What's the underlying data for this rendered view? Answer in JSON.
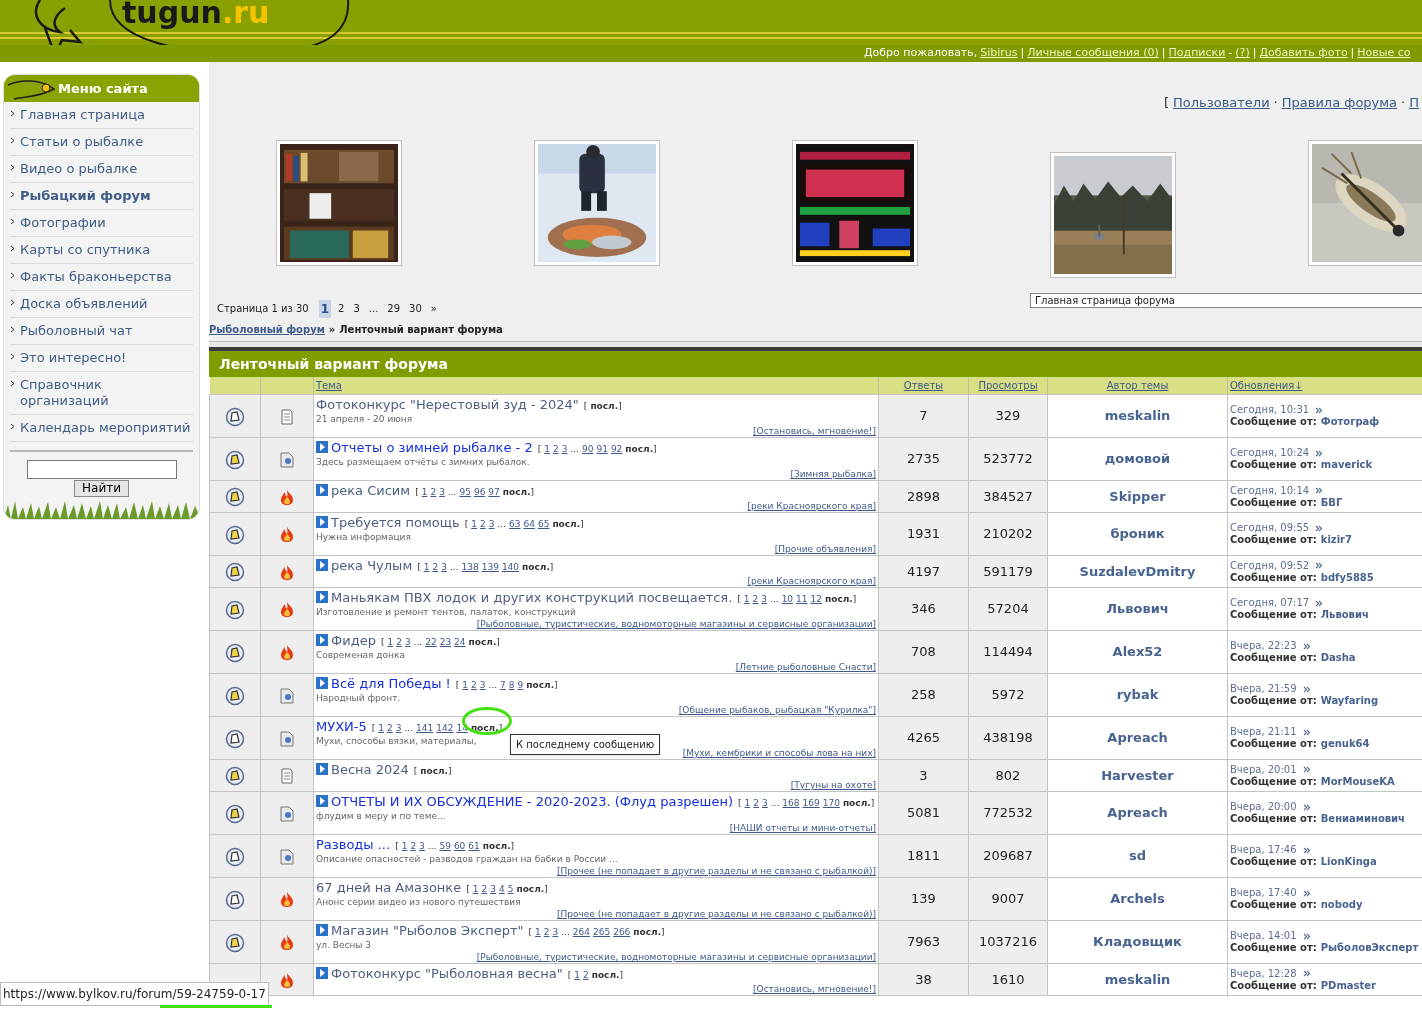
{
  "logo": {
    "main": "tugun",
    "domain": ".ru"
  },
  "user_bar": [
    {
      "kind": "text",
      "text": "Добро пожаловать,"
    },
    {
      "kind": "link",
      "text": "Sibirus"
    },
    {
      "kind": "sep",
      "text": "|"
    },
    {
      "kind": "link",
      "text": "Личные сообщения (0)"
    },
    {
      "kind": "sep",
      "text": "|"
    },
    {
      "kind": "link",
      "text": "Подписки"
    },
    {
      "kind": "sep",
      "text": "-"
    },
    {
      "kind": "link",
      "text": "(?)"
    },
    {
      "kind": "sep",
      "text": "|"
    },
    {
      "kind": "link",
      "text": "Добавить фото"
    },
    {
      "kind": "sep",
      "text": "|"
    },
    {
      "kind": "link",
      "text": "Новые со"
    }
  ],
  "sidebar": {
    "title": "Меню сайта",
    "items": [
      {
        "label": "Главная страница",
        "selected": false
      },
      {
        "label": "Статьи о рыбалке",
        "selected": false
      },
      {
        "label": "Видео о рыбалке",
        "selected": false
      },
      {
        "label": "Рыбацкий форум",
        "selected": true
      },
      {
        "label": "Фотографии",
        "selected": false
      },
      {
        "label": "Карты со спутника",
        "selected": false
      },
      {
        "label": "Факты браконьерства",
        "selected": false
      },
      {
        "label": "Доска объявлений",
        "selected": false
      },
      {
        "label": "Рыболовный чат",
        "selected": false
      },
      {
        "label": "Это интересно!",
        "selected": false
      },
      {
        "label": "Справочник организаций",
        "selected": false
      },
      {
        "label": "Календарь мероприятий",
        "selected": false
      }
    ],
    "search_button": "Найти"
  },
  "top_links": [
    {
      "kind": "sep",
      "text": "["
    },
    {
      "kind": "link",
      "text": "Пользователи"
    },
    {
      "kind": "sep",
      "text": "·"
    },
    {
      "kind": "link",
      "text": "Правила форума"
    },
    {
      "kind": "sep",
      "text": "·"
    },
    {
      "kind": "link",
      "text": "П"
    }
  ],
  "pagination": {
    "label": "Страница 1 из 30",
    "pages": [
      {
        "text": "1",
        "selected": true
      },
      {
        "text": "2",
        "selected": false
      },
      {
        "text": "3",
        "selected": false
      },
      {
        "text": "...",
        "selected": false
      },
      {
        "text": "29",
        "selected": false
      },
      {
        "text": "30",
        "selected": false
      },
      {
        "text": "»",
        "selected": false
      }
    ]
  },
  "forum_select": "Главная страница форума",
  "breadcrumb": {
    "link": "Рыболовный форум",
    "separator": "»",
    "current": "Ленточный вариант форума"
  },
  "table": {
    "title": "Ленточный вариант форума",
    "columns": [
      "Тема",
      "Ответы",
      "Просмотры",
      "Автор темы",
      "Обновления↓"
    ],
    "rows": [
      {
        "unread": false,
        "kind": "note",
        "visited": true,
        "title": "Фотоконкурс \"Нерестовый зуд - 2024\"",
        "pager": [
          {
            "kind": "sep",
            "text": "["
          },
          {
            "kind": "last",
            "text": "посл."
          },
          {
            "kind": "sep",
            "text": "]"
          }
        ],
        "desc": "21 апреля - 20 июня",
        "forum": "[Остановись, мгновение!]",
        "replies": "7",
        "views": "329",
        "author": "meskalin",
        "updated": "Сегодня, 10:31",
        "by_label": "Сообщение от:",
        "by": "Фотограф"
      },
      {
        "unread": true,
        "kind": "doc",
        "new": true,
        "visited": false,
        "title": "Отчеты о зимней рыбалке - 2",
        "pager": [
          {
            "kind": "sep",
            "text": "["
          },
          {
            "kind": "page",
            "text": "1"
          },
          {
            "kind": "page",
            "text": "2"
          },
          {
            "kind": "page",
            "text": "3"
          },
          {
            "kind": "gap",
            "text": "..."
          },
          {
            "kind": "page",
            "text": "90"
          },
          {
            "kind": "page",
            "text": "91"
          },
          {
            "kind": "page",
            "text": "92"
          },
          {
            "kind": "last",
            "text": "посл."
          },
          {
            "kind": "sep",
            "text": "]"
          }
        ],
        "desc": "Здесь размещаем отчёты с зимних рыбалок.",
        "forum": "[Зимняя рыбалка]",
        "replies": "2735",
        "views": "523772",
        "author": "домовой",
        "updated": "Сегодня, 10:24",
        "by_label": "Сообщение от:",
        "by": "maverick"
      },
      {
        "unread": true,
        "kind": "hot",
        "new": true,
        "visited": true,
        "title": "река Сисим",
        "pager": [
          {
            "kind": "sep",
            "text": "["
          },
          {
            "kind": "page",
            "text": "1"
          },
          {
            "kind": "page",
            "text": "2"
          },
          {
            "kind": "page",
            "text": "3"
          },
          {
            "kind": "gap",
            "text": "..."
          },
          {
            "kind": "page",
            "text": "95"
          },
          {
            "kind": "page",
            "text": "96"
          },
          {
            "kind": "page",
            "text": "97"
          },
          {
            "kind": "last",
            "text": "посл."
          },
          {
            "kind": "sep",
            "text": "]"
          }
        ],
        "forum": "[реки Красноярского края]",
        "replies": "2898",
        "views": "384527",
        "author": "Skipper",
        "updated": "Сегодня, 10:14",
        "by_label": "Сообщение от:",
        "by": "БВГ"
      },
      {
        "unread": true,
        "kind": "hot",
        "new": true,
        "visited": true,
        "title": "Требуется помощь",
        "pager": [
          {
            "kind": "sep",
            "text": "["
          },
          {
            "kind": "page",
            "text": "1"
          },
          {
            "kind": "page",
            "text": "2"
          },
          {
            "kind": "page",
            "text": "3"
          },
          {
            "kind": "gap",
            "text": "..."
          },
          {
            "kind": "page",
            "text": "63"
          },
          {
            "kind": "page",
            "text": "64"
          },
          {
            "kind": "page",
            "text": "65"
          },
          {
            "kind": "last",
            "text": "посл."
          },
          {
            "kind": "sep",
            "text": "]"
          }
        ],
        "desc": "Нужна информация",
        "forum": "[Прочие объявления]",
        "replies": "1931",
        "views": "210202",
        "author": "броник",
        "updated": "Сегодня, 09:55",
        "by_label": "Сообщение от:",
        "by": "kizir7"
      },
      {
        "unread": true,
        "kind": "hot",
        "new": true,
        "visited": true,
        "title": "река Чулым",
        "pager": [
          {
            "kind": "sep",
            "text": "["
          },
          {
            "kind": "page",
            "text": "1"
          },
          {
            "kind": "page",
            "text": "2"
          },
          {
            "kind": "page",
            "text": "3"
          },
          {
            "kind": "gap",
            "text": "..."
          },
          {
            "kind": "page",
            "text": "138"
          },
          {
            "kind": "page",
            "text": "139"
          },
          {
            "kind": "page",
            "text": "140"
          },
          {
            "kind": "last",
            "text": "посл."
          },
          {
            "kind": "sep",
            "text": "]"
          }
        ],
        "forum": "[реки Красноярского края]",
        "replies": "4197",
        "views": "591179",
        "author": "SuzdalevDmitry",
        "updated": "Сегодня, 09:52",
        "by_label": "Сообщение от:",
        "by": "bdfy5885"
      },
      {
        "unread": true,
        "kind": "hot",
        "new": true,
        "visited": true,
        "title": "Маньякам ПВХ лодок и других конструкций посвещается.",
        "pager": [
          {
            "kind": "sep",
            "text": "["
          },
          {
            "kind": "page",
            "text": "1"
          },
          {
            "kind": "page",
            "text": "2"
          },
          {
            "kind": "page",
            "text": "3"
          },
          {
            "kind": "gap",
            "text": "..."
          },
          {
            "kind": "page",
            "text": "10"
          },
          {
            "kind": "page",
            "text": "11"
          },
          {
            "kind": "page",
            "text": "12"
          },
          {
            "kind": "last",
            "text": "посл."
          },
          {
            "kind": "sep",
            "text": "]"
          }
        ],
        "desc": "Изготовление и ремонт тентов, палаток, конструкций",
        "forum": "[Рыболовные, туристические, водномоторные магазины и сервисные организации]",
        "replies": "346",
        "views": "57204",
        "author": "Львович",
        "updated": "Сегодня, 07:17",
        "by_label": "Сообщение от:",
        "by": "Львович"
      },
      {
        "unread": true,
        "kind": "hot",
        "new": true,
        "visited": true,
        "title": "Фидер",
        "pager": [
          {
            "kind": "sep",
            "text": "["
          },
          {
            "kind": "page",
            "text": "1"
          },
          {
            "kind": "page",
            "text": "2"
          },
          {
            "kind": "page",
            "text": "3"
          },
          {
            "kind": "gap",
            "text": "..."
          },
          {
            "kind": "page",
            "text": "22"
          },
          {
            "kind": "page",
            "text": "23"
          },
          {
            "kind": "page",
            "text": "24"
          },
          {
            "kind": "last",
            "text": "посл."
          },
          {
            "kind": "sep",
            "text": "]"
          }
        ],
        "desc": "Современая донка",
        "forum": "[Летние рыболовные Снасти]",
        "replies": "708",
        "views": "114494",
        "author": "Alex52",
        "updated": "Вчера, 22:23",
        "by_label": "Сообщение от:",
        "by": "Dasha"
      },
      {
        "unread": true,
        "kind": "doc",
        "new": true,
        "visited": false,
        "title": "Всё для Победы !",
        "pager": [
          {
            "kind": "sep",
            "text": "["
          },
          {
            "kind": "page",
            "text": "1"
          },
          {
            "kind": "page",
            "text": "2"
          },
          {
            "kind": "page",
            "text": "3"
          },
          {
            "kind": "gap",
            "text": "..."
          },
          {
            "kind": "page",
            "text": "7"
          },
          {
            "kind": "page",
            "text": "8"
          },
          {
            "kind": "page",
            "text": "9"
          },
          {
            "kind": "last",
            "text": "посл."
          },
          {
            "kind": "sep",
            "text": "]"
          }
        ],
        "desc": "Народный фронт.",
        "forum": "[Общение рыбаков, рыбацкая \"Курилка\"]",
        "replies": "258",
        "views": "5972",
        "author": "rybak",
        "updated": "Вчера, 21:59",
        "by_label": "Сообщение от:",
        "by": "Wayfaring"
      },
      {
        "unread": false,
        "kind": "doc",
        "visited": false,
        "title": "МУХИ-5",
        "pager": [
          {
            "kind": "sep",
            "text": "["
          },
          {
            "kind": "page",
            "text": "1"
          },
          {
            "kind": "page",
            "text": "2"
          },
          {
            "kind": "page",
            "text": "3"
          },
          {
            "kind": "gap",
            "text": "..."
          },
          {
            "kind": "page",
            "text": "141"
          },
          {
            "kind": "page",
            "text": "142"
          },
          {
            "kind": "page",
            "text": "14"
          },
          {
            "kind": "last",
            "text": "посл."
          },
          {
            "kind": "sep",
            "text": "]"
          }
        ],
        "desc": "Мухи, способы вязки, материалы,",
        "forum": "[Мухи, кембрики и способы лова на них]",
        "replies": "4265",
        "views": "438198",
        "author": "Apreach",
        "updated": "Вчера, 21:11",
        "by_label": "Сообщение от:",
        "by": "genuk64",
        "tooltip": "К последнему сообщению"
      },
      {
        "unread": true,
        "kind": "note",
        "new": true,
        "visited": true,
        "title": "Весна 2024",
        "pager": [
          {
            "kind": "sep",
            "text": "["
          },
          {
            "kind": "last",
            "text": "посл."
          },
          {
            "kind": "sep",
            "text": "]"
          }
        ],
        "forum": "[Тугуны на охоте]",
        "replies": "3",
        "views": "802",
        "author": "Harvester",
        "updated": "Вчера, 20:01",
        "by_label": "Сообщение от:",
        "by": "MorMouseKA"
      },
      {
        "unread": true,
        "kind": "doc",
        "new": true,
        "visited": false,
        "title": "ОТЧЕТЫ И ИХ ОБСУЖДЕНИЕ - 2020-2023. (Флуд разрешен)",
        "pager": [
          {
            "kind": "sep",
            "text": "["
          },
          {
            "kind": "page",
            "text": "1"
          },
          {
            "kind": "page",
            "text": "2"
          },
          {
            "kind": "page",
            "text": "3"
          },
          {
            "kind": "gap",
            "text": "..."
          },
          {
            "kind": "page",
            "text": "168"
          },
          {
            "kind": "page",
            "text": "169"
          },
          {
            "kind": "page",
            "text": "170"
          },
          {
            "kind": "last",
            "text": "посл."
          },
          {
            "kind": "sep",
            "text": "]"
          }
        ],
        "desc": "флудим в меру и по теме...",
        "forum": "[НАШИ отчеты и мини-отчеты]",
        "replies": "5081",
        "views": "772532",
        "author": "Apreach",
        "updated": "Вчера, 20:00",
        "by_label": "Сообщение от:",
        "by": "Вениаминович"
      },
      {
        "unread": false,
        "kind": "doc",
        "visited": false,
        "title": "Разводы ...",
        "pager": [
          {
            "kind": "sep",
            "text": "["
          },
          {
            "kind": "page",
            "text": "1"
          },
          {
            "kind": "page",
            "text": "2"
          },
          {
            "kind": "page",
            "text": "3"
          },
          {
            "kind": "gap",
            "text": "..."
          },
          {
            "kind": "page",
            "text": "59"
          },
          {
            "kind": "page",
            "text": "60"
          },
          {
            "kind": "page",
            "text": "61"
          },
          {
            "kind": "last",
            "text": "посл."
          },
          {
            "kind": "sep",
            "text": "]"
          }
        ],
        "desc": "Описание опасностей - разводов граждан на бабки в России ...",
        "forum": "[Прочее (не попадает в другие разделы и не связано с рыбалкой)]",
        "replies": "1811",
        "views": "209687",
        "author": "sd",
        "updated": "Вчера, 17:46",
        "by_label": "Сообщение от:",
        "by": "LionKinga"
      },
      {
        "unread": false,
        "kind": "hot",
        "visited": true,
        "title": "67 дней на Амазонке",
        "pager": [
          {
            "kind": "sep",
            "text": "["
          },
          {
            "kind": "page",
            "text": "1"
          },
          {
            "kind": "page",
            "text": "2"
          },
          {
            "kind": "page",
            "text": "3"
          },
          {
            "kind": "page",
            "text": "4"
          },
          {
            "kind": "page",
            "text": "5"
          },
          {
            "kind": "last",
            "text": "посл."
          },
          {
            "kind": "sep",
            "text": "]"
          }
        ],
        "desc": "Анонс серии видео из нового путешествия",
        "forum": "[Прочее (не попадает в другие разделы и не связано с рыбалкой)]",
        "replies": "139",
        "views": "9007",
        "author": "Archels",
        "updated": "Вчера, 17:40",
        "by_label": "Сообщение от:",
        "by": "nobody"
      },
      {
        "unread": true,
        "kind": "hot",
        "new": true,
        "visited": true,
        "title": "Магазин \"Рыболов Эксперт\"",
        "pager": [
          {
            "kind": "sep",
            "text": "["
          },
          {
            "kind": "page",
            "text": "1"
          },
          {
            "kind": "page",
            "text": "2"
          },
          {
            "kind": "page",
            "text": "3"
          },
          {
            "kind": "gap",
            "text": "..."
          },
          {
            "kind": "page",
            "text": "264"
          },
          {
            "kind": "page",
            "text": "265"
          },
          {
            "kind": "page",
            "text": "266"
          },
          {
            "kind": "last",
            "text": "посл."
          },
          {
            "kind": "sep",
            "text": "]"
          }
        ],
        "desc": "ул. Весны 3",
        "forum": "[Рыболовные, туристические, водномоторные магазины и сервисные организации]",
        "replies": "7963",
        "views": "1037216",
        "author": "Кладовщик",
        "updated": "Вчера, 14:01",
        "by_label": "Сообщение от:",
        "by": "РыболовЭксперт"
      },
      {
        "kind": "hot",
        "new": true,
        "visited": true,
        "title": "Фотоконкурс \"Рыболовная весна\"",
        "pager": [
          {
            "kind": "sep",
            "text": "["
          },
          {
            "kind": "page",
            "text": "1"
          },
          {
            "kind": "page",
            "text": "2"
          },
          {
            "kind": "last",
            "text": "посл."
          },
          {
            "kind": "sep",
            "text": "]"
          }
        ],
        "forum": "[Остановись, мгновение!]",
        "replies": "38",
        "views": "1610",
        "author": "meskalin",
        "updated": "Вчера, 12:28",
        "by_label": "Сообщение от:",
        "by": "PDmaster"
      }
    ]
  },
  "status_url": "https://www.bylkov.ru/forum/59-24759-0-17"
}
